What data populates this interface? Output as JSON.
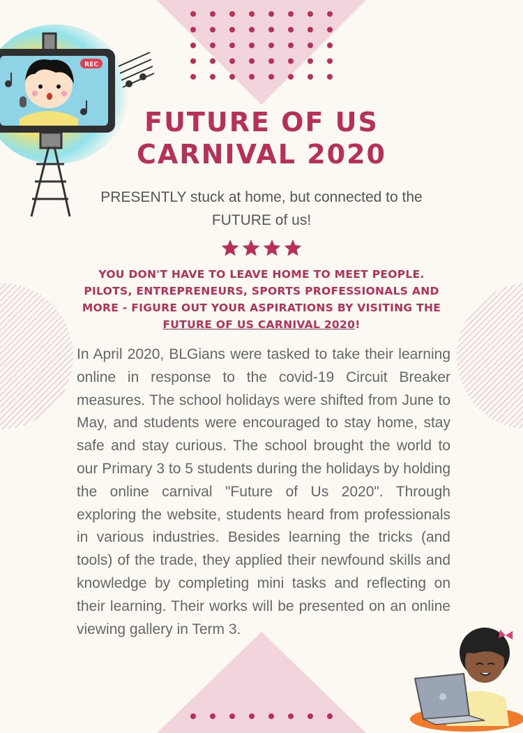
{
  "poster": {
    "title_line1": "FUTURE OF US",
    "title_line2": "CARNIVAL 2020",
    "subtitle": "PRESENTLY stuck at home, but connected to the FUTURE of us!",
    "star_count": 4,
    "tagline_main": "YOU DON'T HAVE TO LEAVE HOME TO MEET PEOPLE. PILOTS, ENTREPRENEURS, SPORTS PROFESSIONALS AND MORE - FIGURE OUT YOUR ASPIRATIONS BY VISITING THE ",
    "tagline_link": "FUTURE OF US CARNIVAL 2020",
    "tagline_end": "!",
    "body": "In April 2020, BLGians were tasked to take their learning online in response to the covid-19 Circuit Breaker measures. The school holidays were shifted from June to May, and students were encouraged to stay home, stay safe and stay curious. The school brought the world to our Primary 3 to 5 students during the holidays by holding the online carnival \"Future of Us 2020\". Through exploring the website, students heard from professionals in various industries. Besides learning the tricks (and tools) of the trade, they applied their newfound skills and knowledge by completing mini tasks and reflecting on their learning. Their works will be presented on an online viewing gallery in Term 3."
  },
  "illustration": {
    "rec_label": "REC"
  },
  "colors": {
    "accent": "#b7305a",
    "triangle": "#f2d5dc",
    "background": "#fbf9f1",
    "body_text": "#666666"
  },
  "icons": [
    "star-icon",
    "music-note-icon"
  ]
}
